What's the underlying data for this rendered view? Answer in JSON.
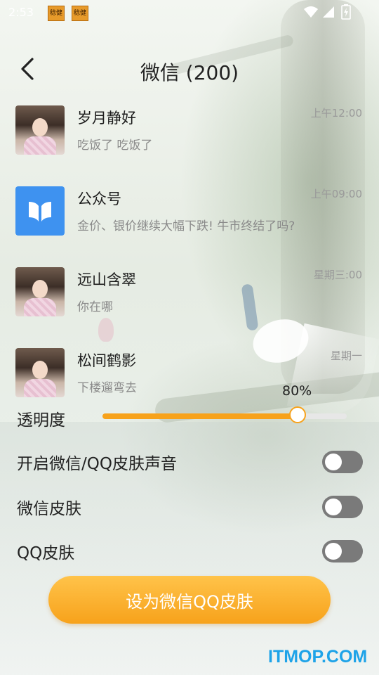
{
  "status_bar": {
    "time": "2:53",
    "notifications": [
      "稔健",
      "稔健"
    ]
  },
  "header": {
    "title": "微信 (200)"
  },
  "chats": [
    {
      "name": "岁月静好",
      "message": "吃饭了 吃饭了",
      "time": "上午12:00",
      "avatar": "portrait-photo"
    },
    {
      "name": "公众号",
      "message": "金价、银价继续大幅下跌! 牛市终结了吗?",
      "time": "上午09:00",
      "avatar": "official-account-icon"
    },
    {
      "name": "远山含翠",
      "message": "你在哪",
      "time": "星期三:00",
      "avatar": "portrait-photo"
    },
    {
      "name": "松间鹤影",
      "message": "下楼遛弯去",
      "time": "星期一",
      "avatar": "portrait-photo"
    }
  ],
  "transparency": {
    "label": "透明度",
    "value_text": "80%",
    "value": 0.8,
    "accent_color": "#f7a21b"
  },
  "toggles": [
    {
      "label": "开启微信/QQ皮肤声音",
      "on": false
    },
    {
      "label": "微信皮肤",
      "on": false
    },
    {
      "label": "QQ皮肤",
      "on": false
    }
  ],
  "cta": {
    "label": "设为微信QQ皮肤"
  },
  "watermark": "ITMOP.COM"
}
